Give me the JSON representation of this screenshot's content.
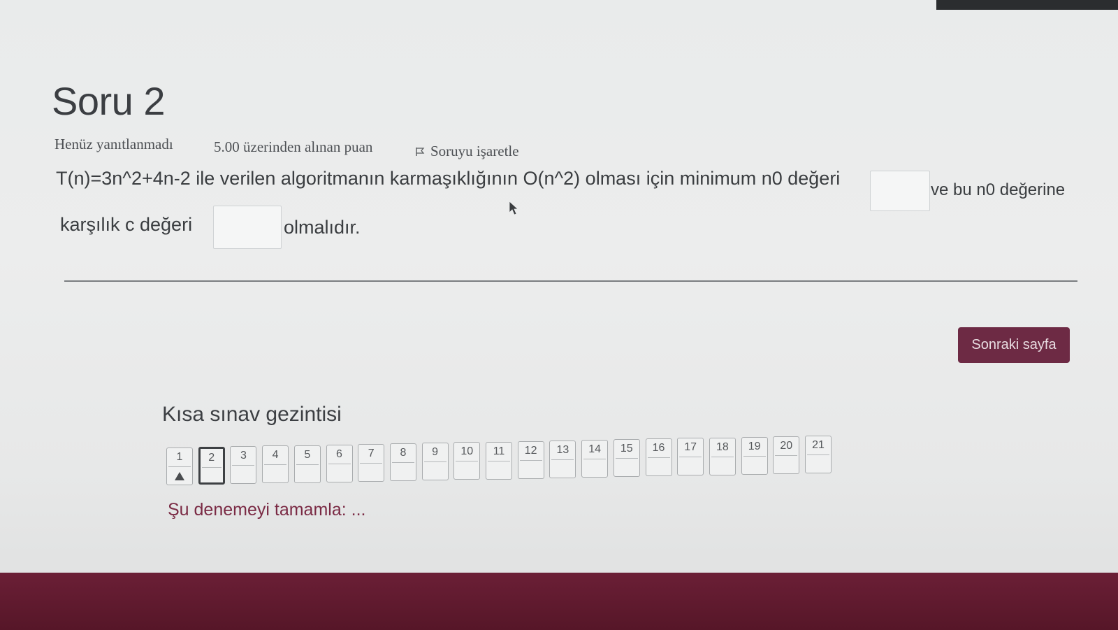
{
  "question": {
    "title": "Soru 2",
    "state": "Henüz yanıtlanmadı",
    "grade": "5.00 üzerinden alınan puan",
    "flag_label": "Soruyu işaretle",
    "text_part1": "T(n)=3n^2+4n-2 ile verilen algoritmanın karmaşıklığının O(n^2) olması için minimum n0 değeri",
    "text_part2": "ve bu n0 değerine",
    "text_part3": "karşılık c değeri",
    "text_part4": "olmalıdır.",
    "blank1_value": "",
    "blank2_value": ""
  },
  "buttons": {
    "next_page": "Sonraki sayfa"
  },
  "quiz_nav": {
    "heading": "Kısa sınav gezintisi",
    "items": [
      "1",
      "2",
      "3",
      "4",
      "5",
      "6",
      "7",
      "8",
      "9",
      "10",
      "11",
      "12",
      "13",
      "14",
      "15",
      "16",
      "17",
      "18",
      "19",
      "20",
      "21"
    ],
    "current": "2",
    "flagged": "1",
    "finish_link": "Şu denemeyi tamamla: ..."
  },
  "colors": {
    "accent": "#6d2a44",
    "footer": "#5d1a2e"
  }
}
